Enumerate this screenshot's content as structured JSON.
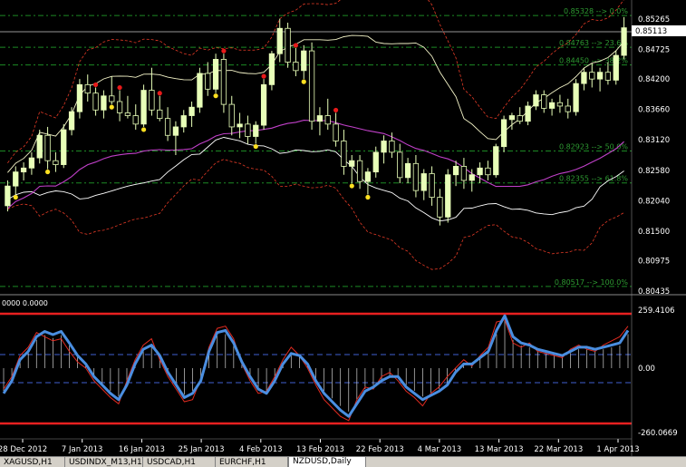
{
  "colors": {
    "background": "#000000",
    "grid": "#1f9a2b",
    "candle_up": "#e8ffb8",
    "candle_down": "#000000",
    "candle_wick": "#e8ffb8",
    "bollinger_outer": "#e33a26",
    "envelope_inner": "#ffffff",
    "envelope_white2": "#f4f4c8",
    "ma_line": "#c040c8",
    "fib_line": "#1c8a24",
    "fib_text": "#2e9a32",
    "cci_line": "#4a8ee0",
    "cci_signal": "#e02a20",
    "cci_limit": "#e82020",
    "cci_dash": "#4060d0",
    "cci_hist": "#d0d0d0",
    "price_box": "#ffffff",
    "dot_red": "#e81a1a",
    "dot_yellow": "#ffe020",
    "axis_text": "#ffffff"
  },
  "main_chart": {
    "price_labels": [
      "0.85265",
      "0.84725",
      "0.84200",
      "0.83660",
      "0.83120",
      "0.82580",
      "0.82040",
      "0.81500",
      "0.80975",
      "0.80435"
    ],
    "current_price": "0.85113",
    "fib_labels": [
      "0.85328 --> 0.0%",
      "0.84763 --> 23.6%",
      "0.84450 --> 38.2%",
      "0.82923 --> 50.0%",
      "0.82355 --> 61.8%",
      "0.80517 --> 100.0%"
    ]
  },
  "sub_chart": {
    "header_label": "0000 0.0000",
    "axis_labels": [
      "259.4106",
      "0.00",
      "-260.0669"
    ]
  },
  "x_axis": {
    "date_labels": [
      "28 Dec 2012",
      "7 Jan 2013",
      "16 Jan 2013",
      "25 Jan 2013",
      "4 Feb 2013",
      "13 Feb 2013",
      "22 Feb 2013",
      "4 Mar 2013",
      "13 Mar 2013",
      "22 Mar 2013",
      "1 Apr 2013"
    ]
  },
  "tabs": [
    {
      "label": "XAGUSD,H1",
      "active": false
    },
    {
      "label": "USDINDX_M13,H1",
      "active": false
    },
    {
      "label": "USDCAD,H1",
      "active": false
    },
    {
      "label": "EURCHF,H1",
      "active": false
    },
    {
      "label": "NZDUSD,Daily",
      "active": true
    }
  ],
  "chart_data": [
    {
      "type": "candlestick",
      "title": "NZDUSD,Daily",
      "x_dates": [
        "28 Dec 2012",
        "7 Jan 2013",
        "16 Jan 2013",
        "25 Jan 2013",
        "4 Feb 2013",
        "13 Feb 2013",
        "22 Feb 2013",
        "4 Mar 2013",
        "13 Mar 2013",
        "22 Mar 2013",
        "1 Apr 2013"
      ],
      "ylim": [
        0.80435,
        0.85265
      ],
      "current_price": 0.85113,
      "candles": [
        {
          "o": 0.8195,
          "h": 0.824,
          "l": 0.8185,
          "c": 0.823
        },
        {
          "o": 0.823,
          "h": 0.8265,
          "l": 0.8215,
          "c": 0.8255
        },
        {
          "o": 0.8255,
          "h": 0.8272,
          "l": 0.824,
          "c": 0.8262
        },
        {
          "o": 0.8262,
          "h": 0.829,
          "l": 0.825,
          "c": 0.828
        },
        {
          "o": 0.828,
          "h": 0.833,
          "l": 0.827,
          "c": 0.832
        },
        {
          "o": 0.832,
          "h": 0.8335,
          "l": 0.826,
          "c": 0.8275
        },
        {
          "o": 0.8275,
          "h": 0.829,
          "l": 0.8255,
          "c": 0.8268
        },
        {
          "o": 0.8268,
          "h": 0.834,
          "l": 0.8262,
          "c": 0.833
        },
        {
          "o": 0.833,
          "h": 0.837,
          "l": 0.832,
          "c": 0.8362
        },
        {
          "o": 0.8362,
          "h": 0.842,
          "l": 0.835,
          "c": 0.841
        },
        {
          "o": 0.841,
          "h": 0.8428,
          "l": 0.838,
          "c": 0.8395
        },
        {
          "o": 0.8395,
          "h": 0.8405,
          "l": 0.8355,
          "c": 0.8365
        },
        {
          "o": 0.8365,
          "h": 0.84,
          "l": 0.835,
          "c": 0.839
        },
        {
          "o": 0.839,
          "h": 0.8425,
          "l": 0.8375,
          "c": 0.838
        },
        {
          "o": 0.838,
          "h": 0.84,
          "l": 0.8345,
          "c": 0.836
        },
        {
          "o": 0.836,
          "h": 0.839,
          "l": 0.835,
          "c": 0.8355
        },
        {
          "o": 0.8355,
          "h": 0.8375,
          "l": 0.833,
          "c": 0.834
        },
        {
          "o": 0.834,
          "h": 0.841,
          "l": 0.8335,
          "c": 0.84
        },
        {
          "o": 0.84,
          "h": 0.844,
          "l": 0.8355,
          "c": 0.8365
        },
        {
          "o": 0.8365,
          "h": 0.839,
          "l": 0.8345,
          "c": 0.835
        },
        {
          "o": 0.835,
          "h": 0.837,
          "l": 0.831,
          "c": 0.832
        },
        {
          "o": 0.832,
          "h": 0.8345,
          "l": 0.8285,
          "c": 0.8335
        },
        {
          "o": 0.8335,
          "h": 0.8365,
          "l": 0.8325,
          "c": 0.8355
        },
        {
          "o": 0.8355,
          "h": 0.838,
          "l": 0.8335,
          "c": 0.837
        },
        {
          "o": 0.837,
          "h": 0.844,
          "l": 0.836,
          "c": 0.843
        },
        {
          "o": 0.843,
          "h": 0.845,
          "l": 0.839,
          "c": 0.8402
        },
        {
          "o": 0.8402,
          "h": 0.8465,
          "l": 0.8395,
          "c": 0.8455
        },
        {
          "o": 0.8455,
          "h": 0.8465,
          "l": 0.836,
          "c": 0.8375
        },
        {
          "o": 0.8375,
          "h": 0.839,
          "l": 0.832,
          "c": 0.8335
        },
        {
          "o": 0.8335,
          "h": 0.836,
          "l": 0.8315,
          "c": 0.834
        },
        {
          "o": 0.834,
          "h": 0.8355,
          "l": 0.8305,
          "c": 0.8318
        },
        {
          "o": 0.8318,
          "h": 0.8345,
          "l": 0.8305,
          "c": 0.8338
        },
        {
          "o": 0.8338,
          "h": 0.842,
          "l": 0.833,
          "c": 0.841
        },
        {
          "o": 0.841,
          "h": 0.847,
          "l": 0.84,
          "c": 0.8465
        },
        {
          "o": 0.8465,
          "h": 0.8527,
          "l": 0.845,
          "c": 0.851
        },
        {
          "o": 0.851,
          "h": 0.852,
          "l": 0.844,
          "c": 0.845
        },
        {
          "o": 0.845,
          "h": 0.8475,
          "l": 0.8425,
          "c": 0.8435
        },
        {
          "o": 0.8435,
          "h": 0.848,
          "l": 0.842,
          "c": 0.847
        },
        {
          "o": 0.847,
          "h": 0.8485,
          "l": 0.833,
          "c": 0.8345
        },
        {
          "o": 0.8345,
          "h": 0.837,
          "l": 0.832,
          "c": 0.8355
        },
        {
          "o": 0.8355,
          "h": 0.8385,
          "l": 0.833,
          "c": 0.834
        },
        {
          "o": 0.834,
          "h": 0.836,
          "l": 0.83,
          "c": 0.831
        },
        {
          "o": 0.831,
          "h": 0.833,
          "l": 0.825,
          "c": 0.8265
        },
        {
          "o": 0.8265,
          "h": 0.8285,
          "l": 0.8235,
          "c": 0.8275
        },
        {
          "o": 0.8275,
          "h": 0.8285,
          "l": 0.8225,
          "c": 0.8238
        },
        {
          "o": 0.8238,
          "h": 0.8262,
          "l": 0.8215,
          "c": 0.8255
        },
        {
          "o": 0.8255,
          "h": 0.83,
          "l": 0.8245,
          "c": 0.829
        },
        {
          "o": 0.829,
          "h": 0.832,
          "l": 0.827,
          "c": 0.831
        },
        {
          "o": 0.831,
          "h": 0.8325,
          "l": 0.828,
          "c": 0.829
        },
        {
          "o": 0.829,
          "h": 0.8305,
          "l": 0.8235,
          "c": 0.8245
        },
        {
          "o": 0.8245,
          "h": 0.828,
          "l": 0.8235,
          "c": 0.827
        },
        {
          "o": 0.827,
          "h": 0.8285,
          "l": 0.821,
          "c": 0.8222
        },
        {
          "o": 0.8222,
          "h": 0.826,
          "l": 0.8205,
          "c": 0.8252
        },
        {
          "o": 0.8252,
          "h": 0.8265,
          "l": 0.8195,
          "c": 0.821
        },
        {
          "o": 0.821,
          "h": 0.8225,
          "l": 0.816,
          "c": 0.8175
        },
        {
          "o": 0.8175,
          "h": 0.826,
          "l": 0.8165,
          "c": 0.825
        },
        {
          "o": 0.825,
          "h": 0.8275,
          "l": 0.823,
          "c": 0.8265
        },
        {
          "o": 0.8265,
          "h": 0.828,
          "l": 0.8225,
          "c": 0.824
        },
        {
          "o": 0.824,
          "h": 0.826,
          "l": 0.822,
          "c": 0.825
        },
        {
          "o": 0.825,
          "h": 0.8272,
          "l": 0.8235,
          "c": 0.8262
        },
        {
          "o": 0.8262,
          "h": 0.8275,
          "l": 0.824,
          "c": 0.825
        },
        {
          "o": 0.825,
          "h": 0.8305,
          "l": 0.8245,
          "c": 0.83
        },
        {
          "o": 0.83,
          "h": 0.8355,
          "l": 0.829,
          "c": 0.8348
        },
        {
          "o": 0.8348,
          "h": 0.836,
          "l": 0.833,
          "c": 0.8355
        },
        {
          "o": 0.8355,
          "h": 0.837,
          "l": 0.834,
          "c": 0.8345
        },
        {
          "o": 0.8345,
          "h": 0.838,
          "l": 0.8338,
          "c": 0.8372
        },
        {
          "o": 0.8372,
          "h": 0.84,
          "l": 0.8365,
          "c": 0.8392
        },
        {
          "o": 0.8392,
          "h": 0.84,
          "l": 0.836,
          "c": 0.8368
        },
        {
          "o": 0.8368,
          "h": 0.8385,
          "l": 0.8355,
          "c": 0.8378
        },
        {
          "o": 0.8378,
          "h": 0.8392,
          "l": 0.836,
          "c": 0.8372
        },
        {
          "o": 0.8372,
          "h": 0.8385,
          "l": 0.835,
          "c": 0.8362
        },
        {
          "o": 0.8362,
          "h": 0.842,
          "l": 0.8355,
          "c": 0.8412
        },
        {
          "o": 0.8412,
          "h": 0.844,
          "l": 0.84,
          "c": 0.8432
        },
        {
          "o": 0.8432,
          "h": 0.8448,
          "l": 0.8405,
          "c": 0.842
        },
        {
          "o": 0.842,
          "h": 0.844,
          "l": 0.8398,
          "c": 0.8432
        },
        {
          "o": 0.8432,
          "h": 0.845,
          "l": 0.841,
          "c": 0.8418
        },
        {
          "o": 0.8418,
          "h": 0.847,
          "l": 0.841,
          "c": 0.8462
        },
        {
          "o": 0.8462,
          "h": 0.853,
          "l": 0.8455,
          "c": 0.8511
        }
      ],
      "fibonacci": [
        {
          "price": 0.85328,
          "label": "0.85328 --> 0.0%"
        },
        {
          "price": 0.84763,
          "label": "0.84763 --> 23.6%"
        },
        {
          "price": 0.8445,
          "label": "0.84450 --> 38.2%"
        },
        {
          "price": 0.82923,
          "label": "0.82923 --> 50.0%"
        },
        {
          "price": 0.82355,
          "label": "0.82355 --> 61.8%"
        },
        {
          "price": 0.80517,
          "label": "0.80517 --> 100.0%"
        }
      ]
    },
    {
      "type": "line",
      "title": "",
      "ylim": [
        -260.0669,
        259.4106
      ],
      "axis_labels": [
        "259.4106",
        "0.00",
        "-260.0669"
      ],
      "levels": [
        259.4106,
        -260.0669
      ],
      "series": [
        {
          "values": [
            -120,
            -60,
            40,
            80,
            150,
            175,
            160,
            175,
            120,
            60,
            20,
            -40,
            -80,
            -120,
            -150,
            -80,
            20,
            90,
            110,
            60,
            -20,
            -80,
            -140,
            -120,
            -60,
            80,
            170,
            180,
            120,
            30,
            -40,
            -100,
            -120,
            -60,
            20,
            70,
            60,
            20,
            -60,
            -120,
            -160,
            -200,
            -230,
            -170,
            -110,
            -90,
            -60,
            -40,
            -40,
            -90,
            -120,
            -150,
            -130,
            -110,
            -80,
            -20,
            20,
            20,
            50,
            80,
            180,
            250,
            150,
            120,
            110,
            90,
            80,
            70,
            60,
            80,
            100,
            100,
            90,
            100,
            110,
            120,
            180
          ]
        },
        {
          "values": [
            -100,
            -40,
            60,
            100,
            170,
            150,
            130,
            140,
            80,
            30,
            0,
            -60,
            -100,
            -140,
            -170,
            -60,
            40,
            110,
            140,
            40,
            -40,
            -100,
            -160,
            -150,
            -50,
            100,
            190,
            200,
            140,
            20,
            -60,
            -120,
            -110,
            -40,
            40,
            100,
            60,
            0,
            -80,
            -150,
            -190,
            -230,
            -250,
            -150,
            -90,
            -100,
            -40,
            -20,
            -60,
            -110,
            -140,
            -180,
            -120,
            -90,
            -40,
            0,
            40,
            10,
            60,
            100,
            220,
            230,
            120,
            100,
            120,
            80,
            70,
            60,
            50,
            90,
            110,
            90,
            80,
            110,
            130,
            150,
            200
          ]
        }
      ]
    }
  ]
}
